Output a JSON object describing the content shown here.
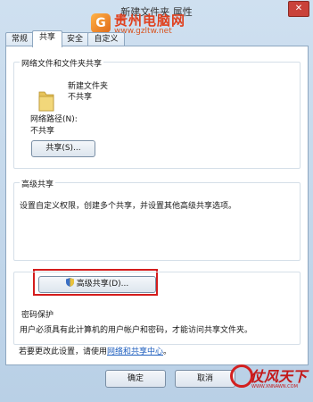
{
  "window": {
    "title": "新建文件夹 属性",
    "close_label": "✕"
  },
  "watermark": {
    "logo_char": "G",
    "name": "贵州电脑网",
    "url": "www.gzltw.net"
  },
  "tabs": [
    {
      "label": "常规"
    },
    {
      "label": "共享"
    },
    {
      "label": "安全"
    },
    {
      "label": "自定义"
    }
  ],
  "network_sharing": {
    "title": "网络文件和文件夹共享",
    "folder_name": "新建文件夹",
    "folder_status": "不共享",
    "path_label": "网络路径(N):",
    "path_value": "不共享",
    "share_button": "共享(S)..."
  },
  "advanced_sharing": {
    "title": "高级共享",
    "description": "设置自定义权限，创建多个共享，并设置其他高级共享选项。",
    "button": "高级共享(D)..."
  },
  "password_protection": {
    "title": "密码保护",
    "description": "用户必须具有此计算机的用户帐户和密码，才能访问共享文件夹。",
    "change_prefix": "若要更改此设置，请使用",
    "link": "网络和共享中心",
    "change_suffix": "。"
  },
  "buttons": {
    "ok": "确定",
    "cancel": "取消"
  },
  "corner_logo": {
    "name": "仗风天下",
    "url": "WWW.XNNAWN.COM"
  },
  "colors": {
    "highlight": "#d41c1c",
    "link": "#1f5fbf"
  }
}
